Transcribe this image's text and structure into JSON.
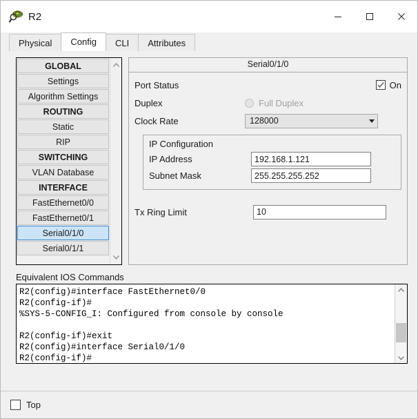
{
  "window": {
    "title": "R2",
    "icon": "router-magnifier-icon",
    "controls": {
      "minimize": "minimize-icon",
      "maximize": "maximize-icon",
      "close": "close-icon"
    }
  },
  "tabs": [
    {
      "label": "Physical",
      "active": false
    },
    {
      "label": "Config",
      "active": true
    },
    {
      "label": "CLI",
      "active": false
    },
    {
      "label": "Attributes",
      "active": false
    }
  ],
  "sidebar": {
    "items": [
      {
        "label": "GLOBAL",
        "type": "header"
      },
      {
        "label": "Settings",
        "type": "item"
      },
      {
        "label": "Algorithm Settings",
        "type": "item"
      },
      {
        "label": "ROUTING",
        "type": "header"
      },
      {
        "label": "Static",
        "type": "item"
      },
      {
        "label": "RIP",
        "type": "item"
      },
      {
        "label": "SWITCHING",
        "type": "header"
      },
      {
        "label": "VLAN Database",
        "type": "item"
      },
      {
        "label": "INTERFACE",
        "type": "header"
      },
      {
        "label": "FastEthernet0/0",
        "type": "item"
      },
      {
        "label": "FastEthernet0/1",
        "type": "item"
      },
      {
        "label": "Serial0/1/0",
        "type": "item",
        "selected": true
      },
      {
        "label": "Serial0/1/1",
        "type": "item"
      }
    ],
    "scroll_up": "chevron-up-icon",
    "scroll_down": "chevron-down-icon"
  },
  "config_panel": {
    "header": "Serial0/1/0",
    "port_status": {
      "label": "Port Status",
      "state_label": "On",
      "checked": true
    },
    "duplex": {
      "label": "Duplex",
      "option_label": "Full Duplex",
      "selected": false,
      "disabled": true
    },
    "clock_rate": {
      "label": "Clock Rate",
      "value": "128000"
    },
    "ip_configuration": {
      "title": "IP Configuration",
      "ip_address": {
        "label": "IP Address",
        "value": "192.168.1.121"
      },
      "subnet_mask": {
        "label": "Subnet Mask",
        "value": "255.255.255.252"
      }
    },
    "tx_ring_limit": {
      "label": "Tx Ring Limit",
      "value": "10"
    }
  },
  "ios": {
    "title": "Equivalent IOS Commands",
    "lines": "R2(config)#interface FastEthernet0/0\nR2(config-if)#\n%SYS-5-CONFIG_I: Configured from console by console\n\nR2(config-if)#exit\nR2(config)#interface Serial0/1/0\nR2(config-if)#"
  },
  "footer": {
    "top_checkbox": {
      "label": "Top",
      "checked": false
    }
  },
  "colors": {
    "selection_bg": "#cce4f7",
    "selection_border": "#3a87cd",
    "window_bg": "#f0f0f0",
    "field_bg": "#ffffff"
  }
}
